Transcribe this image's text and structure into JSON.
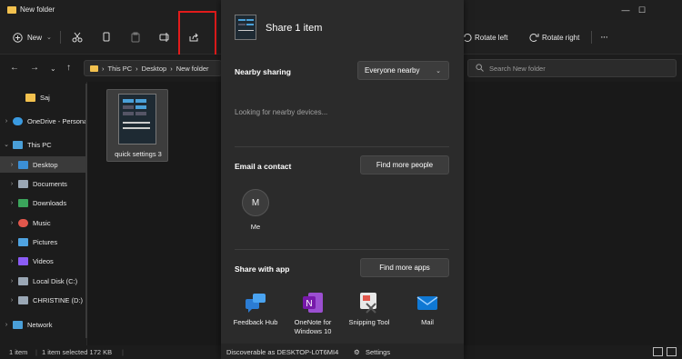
{
  "window": {
    "title": "New folder",
    "minimize_glyph": "—",
    "maximize_glyph": "☐"
  },
  "toolbar": {
    "new_label": "New",
    "rotate_left_label": "Rotate left",
    "rotate_right_label": "Rotate right",
    "more_glyph": "···"
  },
  "address": {
    "path": [
      "This PC",
      "Desktop",
      "New folder"
    ],
    "separator": "›"
  },
  "search": {
    "placeholder": "Search New folder"
  },
  "nav_pane": {
    "items": [
      {
        "label": "Saj",
        "icon": "folder-icon",
        "color": "#f2c14e"
      },
      {
        "label": "OneDrive - Personal",
        "icon": "cloud-icon",
        "color": "#3a9ae0"
      },
      {
        "label": "This PC",
        "icon": "computer-icon",
        "color": "#4a9fd8"
      },
      {
        "label": "Desktop",
        "icon": "desktop-icon",
        "color": "#3b8fd6",
        "selected": true
      },
      {
        "label": "Documents",
        "icon": "documents-icon",
        "color": "#9aa7b5"
      },
      {
        "label": "Downloads",
        "icon": "downloads-icon",
        "color": "#3ba55c"
      },
      {
        "label": "Music",
        "icon": "music-icon",
        "color": "#e2574c"
      },
      {
        "label": "Pictures",
        "icon": "pictures-icon",
        "color": "#4fa3e0"
      },
      {
        "label": "Videos",
        "icon": "videos-icon",
        "color": "#8b5cf6"
      },
      {
        "label": "Local Disk (C:)",
        "icon": "disk-icon",
        "color": "#9aa7b5"
      },
      {
        "label": "CHRISTINE (D:)",
        "icon": "drive-icon",
        "color": "#9aa7b5"
      },
      {
        "label": "Network",
        "icon": "network-icon",
        "color": "#4a9fd8"
      }
    ]
  },
  "content": {
    "file_name": "quick settings 3"
  },
  "status": {
    "item_count": "1 item",
    "selection": "1 item selected  172 KB"
  },
  "share": {
    "title": "Share 1 item",
    "nearby_label": "Nearby sharing",
    "nearby_option": "Everyone nearby",
    "looking_text": "Looking for nearby devices...",
    "email_label": "Email a contact",
    "find_people_label": "Find more people",
    "contact_initial": "M",
    "contact_name": "Me",
    "share_app_label": "Share with app",
    "find_apps_label": "Find more apps",
    "apps": [
      {
        "name": "Feedback Hub",
        "icon": "feedback-hub-icon"
      },
      {
        "name": "OneNote for Windows 10",
        "icon": "onenote-icon"
      },
      {
        "name": "Snipping Tool",
        "icon": "snipping-tool-icon"
      },
      {
        "name": "Mail",
        "icon": "mail-icon"
      }
    ],
    "footer_discoverable": "Discoverable as DESKTOP-L0T6MI4",
    "footer_settings": "Settings"
  }
}
